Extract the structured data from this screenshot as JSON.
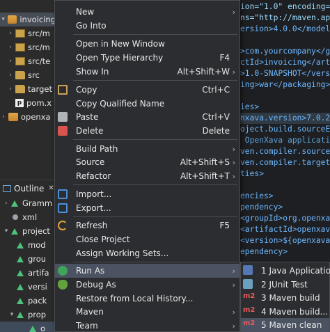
{
  "explorer": {
    "items": [
      {
        "label": "invoicing",
        "twisty": "▾",
        "icon": "project-icon"
      },
      {
        "label": "src/m",
        "twisty": "›",
        "icon": "package-folder-icon"
      },
      {
        "label": "src/m",
        "twisty": "›",
        "icon": "package-folder-icon"
      },
      {
        "label": "src/te",
        "twisty": "›",
        "icon": "package-folder-icon"
      },
      {
        "label": "src",
        "twisty": "›",
        "icon": "folder-icon"
      },
      {
        "label": "target",
        "twisty": "›",
        "icon": "folder-icon"
      },
      {
        "label": "pom.x",
        "twisty": "",
        "icon": "pom-file-icon"
      },
      {
        "label": "openxa",
        "twisty": "›",
        "icon": "project-icon"
      }
    ]
  },
  "outline": {
    "title": "Outline",
    "close": "✕",
    "items": [
      {
        "label": "Gramm",
        "twisty": "›"
      },
      {
        "label": "xml",
        "twisty": ""
      },
      {
        "label": "project",
        "twisty": "▾"
      },
      {
        "label": "mod",
        "twisty": ""
      },
      {
        "label": "grou",
        "twisty": ""
      },
      {
        "label": "artifa",
        "twisty": ""
      },
      {
        "label": "versi",
        "twisty": ""
      },
      {
        "label": "pack",
        "twisty": ""
      },
      {
        "label": "prop",
        "twisty": "▾"
      },
      {
        "label": "o",
        "twisty": ""
      }
    ]
  },
  "editor": {
    "lines": [
      "ion=\"1.0\" encoding=\"UT",
      "ns=\"http://maven.apa",
      "ersion>4.0.0</modelVe",
      "",
      ">com.yourcompany</gr",
      "ctId>invoicing</artif",
      ">1.0-SNAPSHOT</versi",
      "ing>war</packaging>",
      "",
      "ies>",
      "nxava.version>7.0.2<",
      "oject.build.sourceEnc",
      " OpenXava applicatio",
      "ven.compiler.source>",
      "ven.compiler.target>",
      "ties>",
      "",
      "encies>",
      "pendency>",
      "<groupId>org.openxava",
      "<artifactId>openxava",
      "<version>${openxava.",
      "ependency>",
      "",
      "ccess to your databa",
      " the below dependenc",
      "ependency>",
      "",
      "",
      ""
    ]
  },
  "menu": {
    "items": [
      {
        "label": "New",
        "shortcut": "",
        "submenu": true,
        "icon": ""
      },
      {
        "label": "Go Into",
        "shortcut": "",
        "submenu": false,
        "icon": ""
      },
      {
        "label": "Open in New Window",
        "shortcut": "",
        "submenu": false,
        "icon": ""
      },
      {
        "label": "Open Type Hierarchy",
        "shortcut": "F4",
        "submenu": false,
        "icon": ""
      },
      {
        "label": "Show In",
        "shortcut": "Alt+Shift+W",
        "submenu": true,
        "icon": ""
      },
      {
        "label": "Copy",
        "shortcut": "Ctrl+C",
        "submenu": false,
        "icon": "copy-icon"
      },
      {
        "label": "Copy Qualified Name",
        "shortcut": "",
        "submenu": false,
        "icon": ""
      },
      {
        "label": "Paste",
        "shortcut": "Ctrl+V",
        "submenu": false,
        "icon": "paste-icon"
      },
      {
        "label": "Delete",
        "shortcut": "Delete",
        "submenu": false,
        "icon": "delete-icon"
      },
      {
        "label": "Build Path",
        "shortcut": "",
        "submenu": true,
        "icon": ""
      },
      {
        "label": "Source",
        "shortcut": "Alt+Shift+S",
        "submenu": true,
        "icon": ""
      },
      {
        "label": "Refactor",
        "shortcut": "Alt+Shift+T",
        "submenu": true,
        "icon": ""
      },
      {
        "label": "Import...",
        "shortcut": "",
        "submenu": false,
        "icon": "import-icon"
      },
      {
        "label": "Export...",
        "shortcut": "",
        "submenu": false,
        "icon": "export-icon"
      },
      {
        "label": "Refresh",
        "shortcut": "F5",
        "submenu": false,
        "icon": "refresh-icon"
      },
      {
        "label": "Close Project",
        "shortcut": "",
        "submenu": false,
        "icon": ""
      },
      {
        "label": "Assign Working Sets...",
        "shortcut": "",
        "submenu": false,
        "icon": ""
      },
      {
        "label": "Run As",
        "shortcut": "",
        "submenu": true,
        "icon": "run-icon"
      },
      {
        "label": "Debug As",
        "shortcut": "",
        "submenu": true,
        "icon": "debug-icon"
      },
      {
        "label": "Restore from Local History...",
        "shortcut": "",
        "submenu": false,
        "icon": ""
      },
      {
        "label": "Maven",
        "shortcut": "",
        "submenu": true,
        "icon": ""
      },
      {
        "label": "Team",
        "shortcut": "",
        "submenu": true,
        "icon": ""
      }
    ]
  },
  "submenu": {
    "items": [
      {
        "label": "1 Java Application",
        "icon": "java-application-icon",
        "badge": ""
      },
      {
        "label": "2 JUnit Test",
        "icon": "junit-icon",
        "badge": ""
      },
      {
        "label": "3 Maven build",
        "icon": "maven-icon",
        "badge": "m2"
      },
      {
        "label": "4 Maven build...",
        "icon": "maven-icon",
        "badge": "m2"
      },
      {
        "label": "5 Maven clean",
        "icon": "maven-icon",
        "badge": "m2"
      }
    ]
  }
}
